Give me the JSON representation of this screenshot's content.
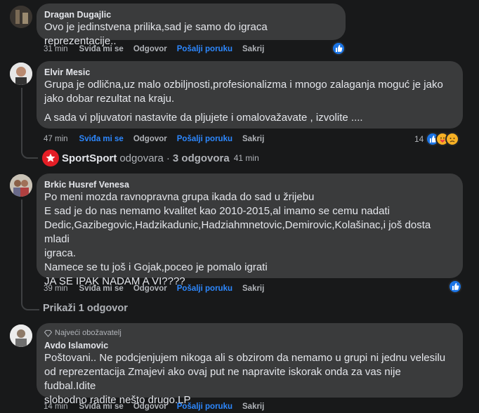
{
  "comments": [
    {
      "author": "Dragan Dugajlic",
      "lines": [
        "Ovo je jedinstvena prilika,sad je samo do igraca reprezentacije.."
      ],
      "time": "31 min",
      "like": "Sviđa mi se",
      "reply": "Odgovor",
      "message": "Pošalji poruku",
      "hide": "Sakrij"
    },
    {
      "author": "Elvir Mesic",
      "lines": [
        "Grupa je odlična,uz malo ozbiljnosti,profesionalizma i mnogo zalaganja moguć je jako",
        "jako dobar rezultat na kraju.",
        "",
        "A sada vi pljuvatori nastavite da pljujete i omalovažavate , izvolite ...."
      ],
      "time": "47 min",
      "like": "Sviđa mi se",
      "reply": "Odgovor",
      "message": "Pošalji poruku",
      "hide": "Sakrij",
      "reaction_count": "14",
      "replies_row": {
        "name": "SportSport",
        "action": "odgovara",
        "count": "3 odgovora",
        "time": "41 min"
      }
    },
    {
      "author": "Brkic Husref Venesa",
      "lines": [
        "Po meni mozda ravnopravna grupa ikada do sad u žrijebu",
        "E sad je do nas nemamo kvalitet kao 2010-2015,al imamo se cemu nadati",
        "Dedic,Gazibegovic,Hadzikadunic,Hadziahmnetovic,Demirovic,Kolašinac,i još dosta mladi",
        "igraca.",
        "Namece se tu još i Gojak,poceo je pomalo igrati",
        "JA SE IPAK NADAM A VI????"
      ],
      "time": "39 min",
      "like": "Sviđa mi se",
      "reply": "Odgovor",
      "message": "Pošalji poruku",
      "hide": "Sakrij",
      "show_replies": "Prikaži 1 odgovor"
    },
    {
      "badge": "Najveći obožavatelj",
      "author": "Avdo Islamovic",
      "lines": [
        "Poštovani.. Ne podcjenjujem nikoga ali s obzirom da nemamo u grupi ni jednu velesilu",
        "od reprezentacija Zmajevi ako ovaj put ne napravite iskorak onda za vas nije fudbal.Idite",
        "slobodno radite nešto drugo.LP"
      ],
      "time": "14 min",
      "like": "Sviđa mi se",
      "reply": "Odgovor",
      "message": "Pošalji poruku",
      "hide": "Sakrij"
    }
  ],
  "icons": {
    "like": "thumbs-up-icon",
    "care": "care-emoji-icon",
    "sad": "sad-emoji-icon",
    "diamond": "diamond-icon",
    "sport_logo": "sportsport-logo"
  },
  "colors": {
    "bubble": "#3a3b3c",
    "link": "#2d88ff",
    "like": "#1b74e4",
    "bg": "#18191a"
  }
}
